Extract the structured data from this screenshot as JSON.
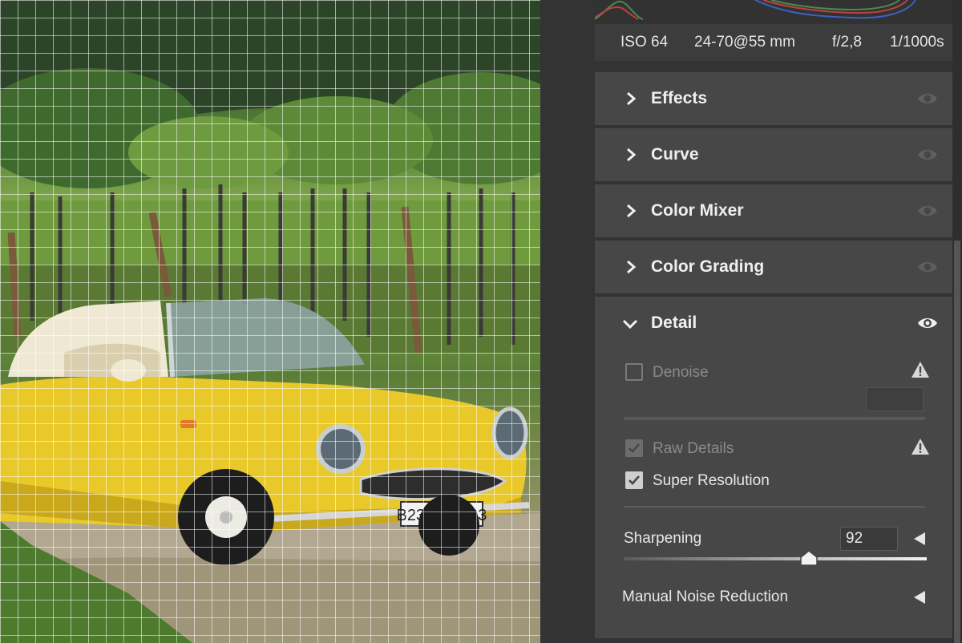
{
  "metadata": {
    "iso": "ISO 64",
    "lens": "24-70@55 mm",
    "aperture": "f/2,8",
    "shutter": "1/1000s"
  },
  "sections": [
    {
      "label": "Effects",
      "icon": "chevron-right-icon",
      "visibility_icon": "eye-icon"
    },
    {
      "label": "Curve",
      "icon": "chevron-right-icon",
      "visibility_icon": "eye-icon"
    },
    {
      "label": "Color Mixer",
      "icon": "chevron-right-icon",
      "visibility_icon": "eye-icon"
    },
    {
      "label": "Color Grading",
      "icon": "chevron-right-icon",
      "visibility_icon": "eye-icon"
    }
  ],
  "detail": {
    "label": "Detail",
    "icon": "chevron-down-icon",
    "visibility_icon": "eye-icon",
    "denoise": {
      "label": "Denoise",
      "checked": false,
      "enabled": false,
      "warning_icon": "warning-icon"
    },
    "raw_details": {
      "label": "Raw Details",
      "checked": true,
      "enabled": false,
      "warning_icon": "warning-icon"
    },
    "super_resolution": {
      "label": "Super Resolution",
      "checked": true
    },
    "sharpening": {
      "label": "Sharpening",
      "value": "92",
      "slider_fraction": 0.61
    },
    "manual_noise_reduction": {
      "label": "Manual Noise Reduction",
      "expand_icon": "triangle-left-icon"
    }
  },
  "photo": {
    "license_plate": "В231НУ 193"
  },
  "colors": {
    "panel_bg": "#474747",
    "accent_text": "#efefef",
    "dim_text": "#8a8a8a"
  }
}
